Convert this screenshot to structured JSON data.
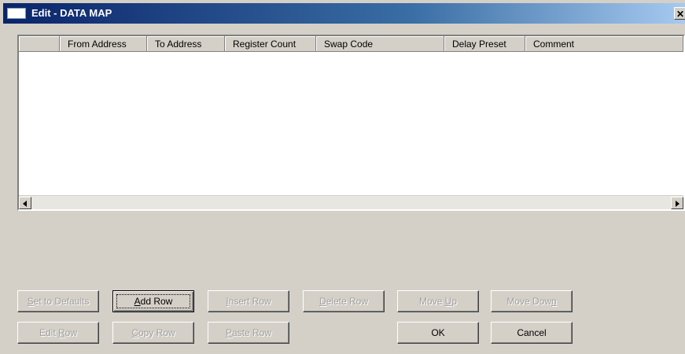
{
  "window": {
    "title": "Edit - DATA MAP",
    "close_glyph": "✕"
  },
  "grid": {
    "columns": [
      "",
      "From Address",
      "To Address",
      "Register Count",
      "Swap Code",
      "Delay Preset",
      "Comment"
    ],
    "rows": []
  },
  "buttons": {
    "set_defaults": {
      "label": "Set to Defaults",
      "accel": "S",
      "rest": "et to Defaults",
      "enabled": false
    },
    "add_row": {
      "label": "Add Row",
      "accel": "A",
      "rest": "dd Row",
      "enabled": true
    },
    "insert_row": {
      "label": "Insert Row",
      "accel": "I",
      "rest": "nsert Row",
      "enabled": false
    },
    "delete_row": {
      "label": "Delete Row",
      "accel": "D",
      "rest": "elete Row",
      "enabled": false
    },
    "move_up": {
      "label": "Move Up",
      "pre": "Move ",
      "accel": "U",
      "rest": "p",
      "enabled": false
    },
    "move_down": {
      "label": "Move Down",
      "pre": "Move Dow",
      "accel": "n",
      "enabled": false
    },
    "edit_row": {
      "label": "Edit Row",
      "pre": "Edit ",
      "accel": "R",
      "rest": "ow",
      "enabled": false
    },
    "copy_row": {
      "label": "Copy Row",
      "accel": "C",
      "rest": "opy Row",
      "enabled": false
    },
    "paste_row": {
      "label": "Paste Row",
      "accel": "P",
      "rest": "aste Row",
      "enabled": false
    },
    "ok": {
      "label": "OK",
      "enabled": true
    },
    "cancel": {
      "label": "Cancel",
      "enabled": true
    }
  }
}
